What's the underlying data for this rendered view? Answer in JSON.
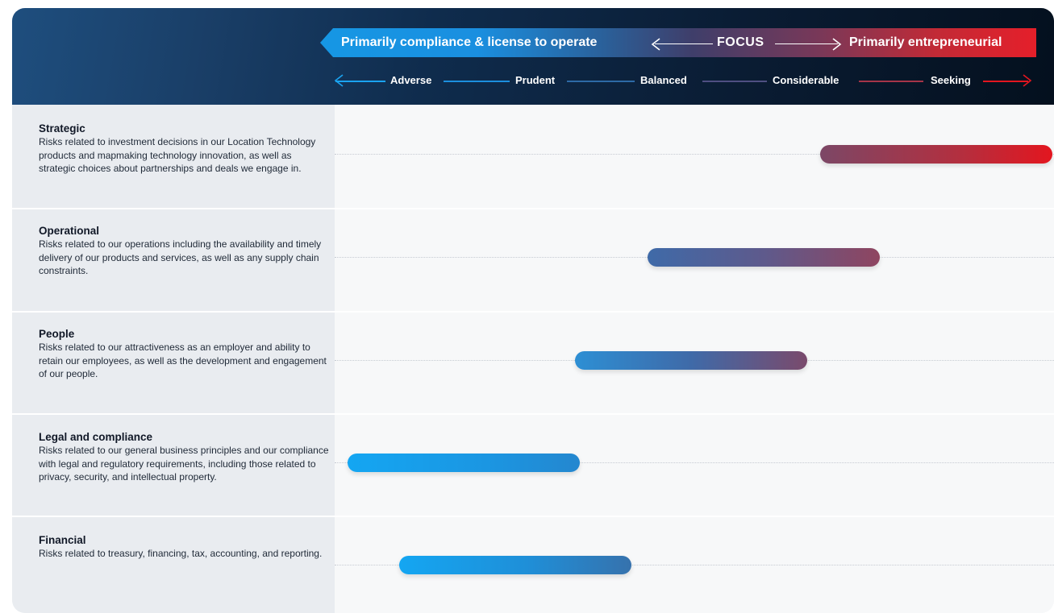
{
  "header": {
    "focus_left": "Primarily compliance & license to operate",
    "focus_center": "FOCUS",
    "focus_right": "Primarily entrepreneurial",
    "scale": [
      "Adverse",
      "Prudent",
      "Balanced",
      "Considerable",
      "Seeking"
    ]
  },
  "categories": [
    {
      "title": "Strategic",
      "description": "Risks related to investment decisions in our Location Technology products and mapmaking technology innovation, as well as strategic choices about partnerships and deals we engage in.",
      "range": [
        "Considerable",
        "Seeking"
      ]
    },
    {
      "title": "Operational",
      "description": "Risks related to our operations including the availability and timely delivery of our products and services, as well as any supply chain constraints.",
      "range": [
        "Balanced",
        "Considerable"
      ]
    },
    {
      "title": "People",
      "description": "Risks related to our attractiveness as an employer and ability to retain our employees, as well as the development and engagement of our people.",
      "range": [
        "Prudent",
        "Considerable"
      ]
    },
    {
      "title": "Legal and compliance",
      "description": "Risks related to our general business principles and our compliance with legal and regulatory requirements, including those related to privacy, security, and intellectual property.",
      "range": [
        "Adverse",
        "Prudent"
      ]
    },
    {
      "title": "Financial",
      "description": "Risks related to treasury, financing, tax, accounting, and reporting.",
      "range": [
        "Adverse",
        "Balanced"
      ]
    }
  ],
  "colors": {
    "blue": "#12a2ef",
    "slate_blue": "#3f6aa8",
    "purple": "#7c4766",
    "red": "#e3161f",
    "header_dark": "#0a1c33"
  }
}
